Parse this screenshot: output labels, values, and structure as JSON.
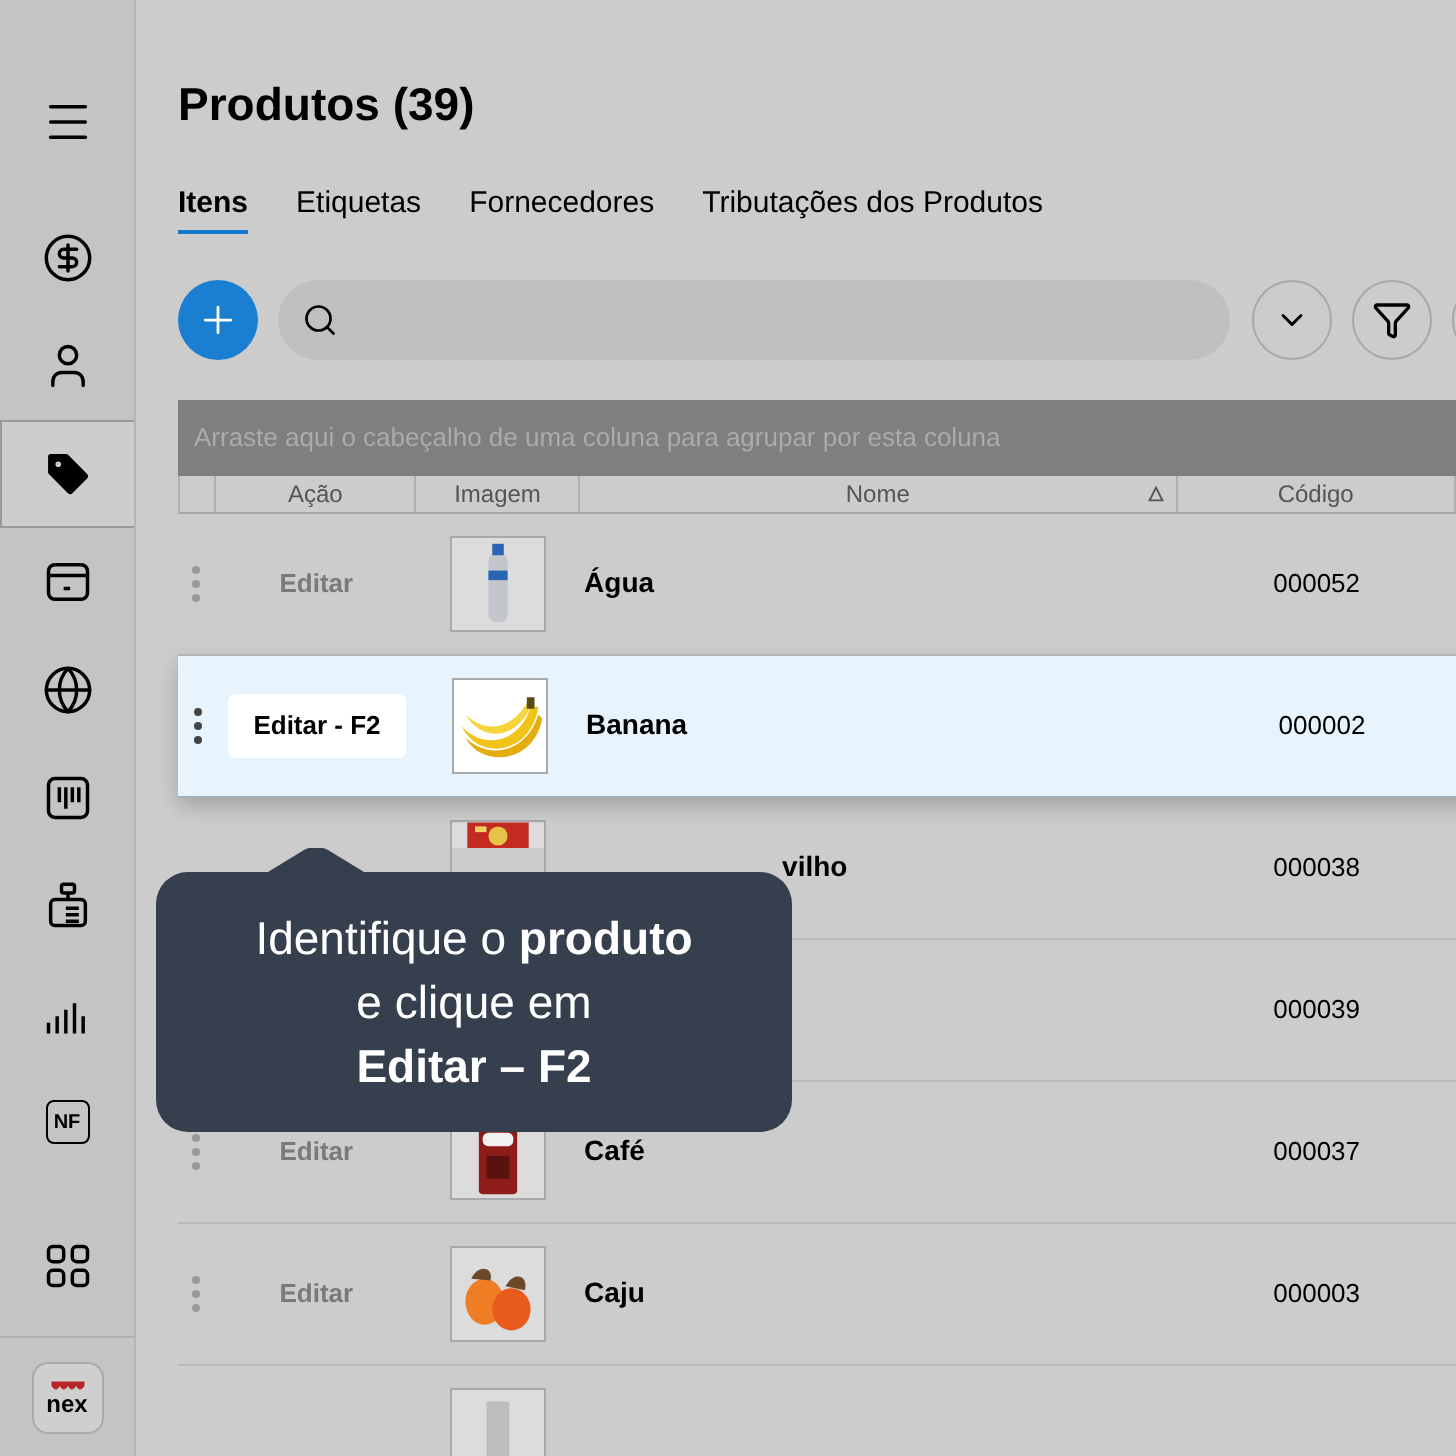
{
  "sidebar": {
    "items": [
      {
        "selected": false
      },
      {
        "selected": false
      },
      {
        "selected": false
      },
      {
        "selected": true
      },
      {
        "selected": false
      },
      {
        "selected": false
      },
      {
        "selected": false
      },
      {
        "selected": false
      },
      {
        "selected": false
      },
      {
        "selected": false,
        "label": "NF"
      },
      {
        "selected": false
      }
    ],
    "logo": "nex"
  },
  "page": {
    "title": "Produtos (39)"
  },
  "tabs": [
    {
      "label": "Itens",
      "selected": true
    },
    {
      "label": "Etiquetas",
      "selected": false
    },
    {
      "label": "Fornecedores",
      "selected": false
    },
    {
      "label": "Tributações dos Produtos",
      "selected": false
    }
  ],
  "group_panel": "Arraste aqui o cabeçalho de uma coluna para agrupar por esta coluna",
  "table": {
    "columns": [
      "Ação",
      "Imagem",
      "Nome",
      "Código"
    ],
    "rows": [
      {
        "action": "Editar",
        "name": "Água",
        "code": "000052",
        "selected": false
      },
      {
        "action": "Editar - F2",
        "name": "Banana",
        "code": "000002",
        "selected": true
      },
      {
        "name": "vilho",
        "code": "000038",
        "selected": false
      },
      {
        "code": "000039",
        "selected": false
      },
      {
        "action": "Editar",
        "name": "Café",
        "code": "000037",
        "selected": false
      },
      {
        "action": "Editar",
        "name": "Caju",
        "code": "000003",
        "selected": false
      },
      {
        "selected": false
      }
    ]
  },
  "tooltip": "Identifique o **produto**\ne clique em\n**Editar – F2**"
}
